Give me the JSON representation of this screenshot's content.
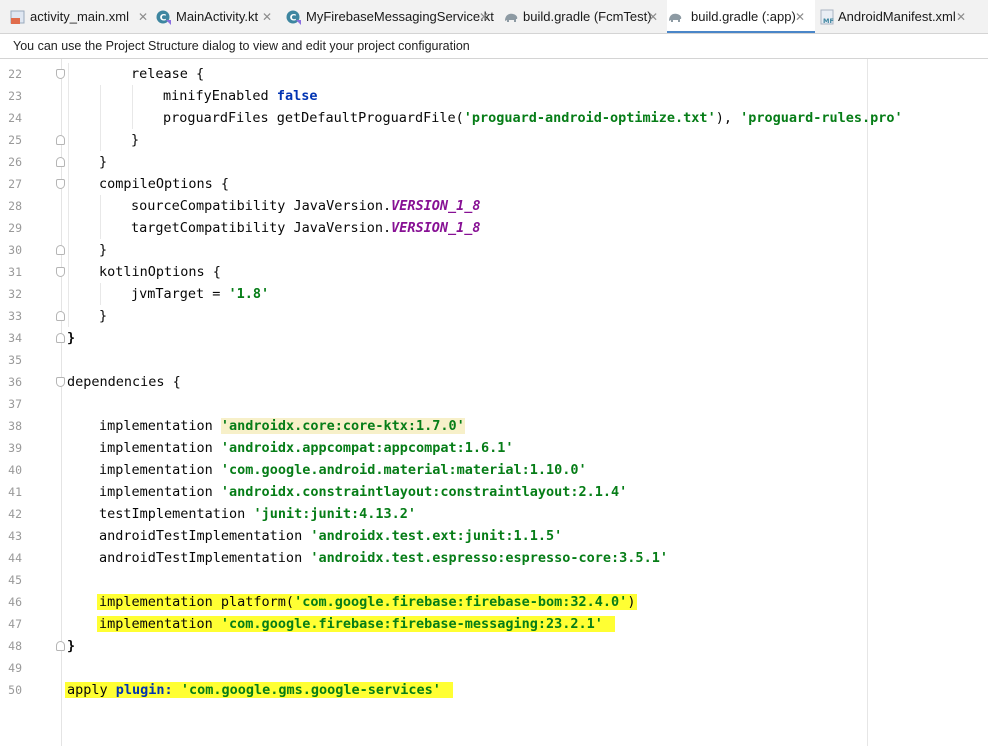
{
  "tabs": [
    {
      "label": "activity_main.xml",
      "icon": "xml-layout-icon"
    },
    {
      "label": "MainActivity.kt",
      "icon": "kotlin-class-icon"
    },
    {
      "label": "MyFirebaseMessagingService.kt",
      "icon": "kotlin-class-icon"
    },
    {
      "label": "build.gradle (FcmTest)",
      "icon": "gradle-elephant-icon"
    },
    {
      "label": "build.gradle (:app)",
      "icon": "gradle-elephant-icon",
      "active": true
    },
    {
      "label": "AndroidManifest.xml",
      "icon": "manifest-icon"
    }
  ],
  "notice": "You can use the Project Structure dialog to view and edit your project configuration",
  "editor": {
    "line_numbers": [
      "22",
      "23",
      "24",
      "25",
      "26",
      "27",
      "28",
      "29",
      "30",
      "31",
      "32",
      "33",
      "34",
      "35",
      "36",
      "37",
      "38",
      "39",
      "40",
      "41",
      "42",
      "43",
      "44",
      "45",
      "46",
      "47",
      "48",
      "49",
      "50"
    ],
    "code": {
      "l22": {
        "kw": "release",
        "rest": " {"
      },
      "l23": {
        "kw": "minifyEnabled",
        "val": "false"
      },
      "l24": {
        "kw": "proguardFiles getDefaultProguardFile(",
        "s1": "'proguard-android-optimize.txt'",
        "mid": "), ",
        "s2": "'proguard-rules.pro'"
      },
      "l25": "}",
      "l26": "}",
      "l27": {
        "kw": "compileOptions",
        "rest": " {"
      },
      "l28": {
        "kw": "sourceCompatibility JavaVersion.",
        "const": "VERSION_1_8"
      },
      "l29": {
        "kw": "targetCompatibility JavaVersion.",
        "const": "VERSION_1_8"
      },
      "l30": "}",
      "l31": {
        "kw": "kotlinOptions",
        "rest": " {"
      },
      "l32": {
        "kw": "jvmTarget = ",
        "str": "'1.8'"
      },
      "l33": "}",
      "l34": "}",
      "l36": {
        "kw": "dependencies",
        "rest": " {"
      },
      "l38": {
        "kw": "implementation ",
        "str": "'androidx.core:core-ktx:1.7.0'"
      },
      "l39": {
        "kw": "implementation ",
        "str": "'androidx.appcompat:appcompat:1.6.1'"
      },
      "l40": {
        "kw": "implementation ",
        "str": "'com.google.android.material:material:1.10.0'"
      },
      "l41": {
        "kw": "implementation ",
        "str": "'androidx.constraintlayout:constraintlayout:2.1.4'"
      },
      "l42": {
        "kw": "testImplementation ",
        "str": "'junit:junit:4.13.2'"
      },
      "l43": {
        "kw": "androidTestImplementation ",
        "str": "'androidx.test.ext:junit:1.1.5'"
      },
      "l44": {
        "kw": "androidTestImplementation ",
        "str": "'androidx.test.espresso:espresso-core:3.5.1'"
      },
      "l46": {
        "kw": "implementation platform(",
        "str": "'com.google.firebase:firebase-bom:32.4.0'",
        "tail": ")"
      },
      "l47": {
        "kw": "implementation ",
        "str": "'com.google.firebase:firebase-messaging:23.2.1'"
      },
      "l48": "}",
      "l50": {
        "kw": "apply ",
        "kw2": "plugin:",
        "sp": " ",
        "str": "'com.google.gms.google-services'"
      }
    }
  },
  "colors": {
    "highlight": "#ffff33",
    "string": "#067d17",
    "keyword": "#0033b3",
    "constant": "#871094",
    "active_tab_underline": "#4a86c8"
  }
}
